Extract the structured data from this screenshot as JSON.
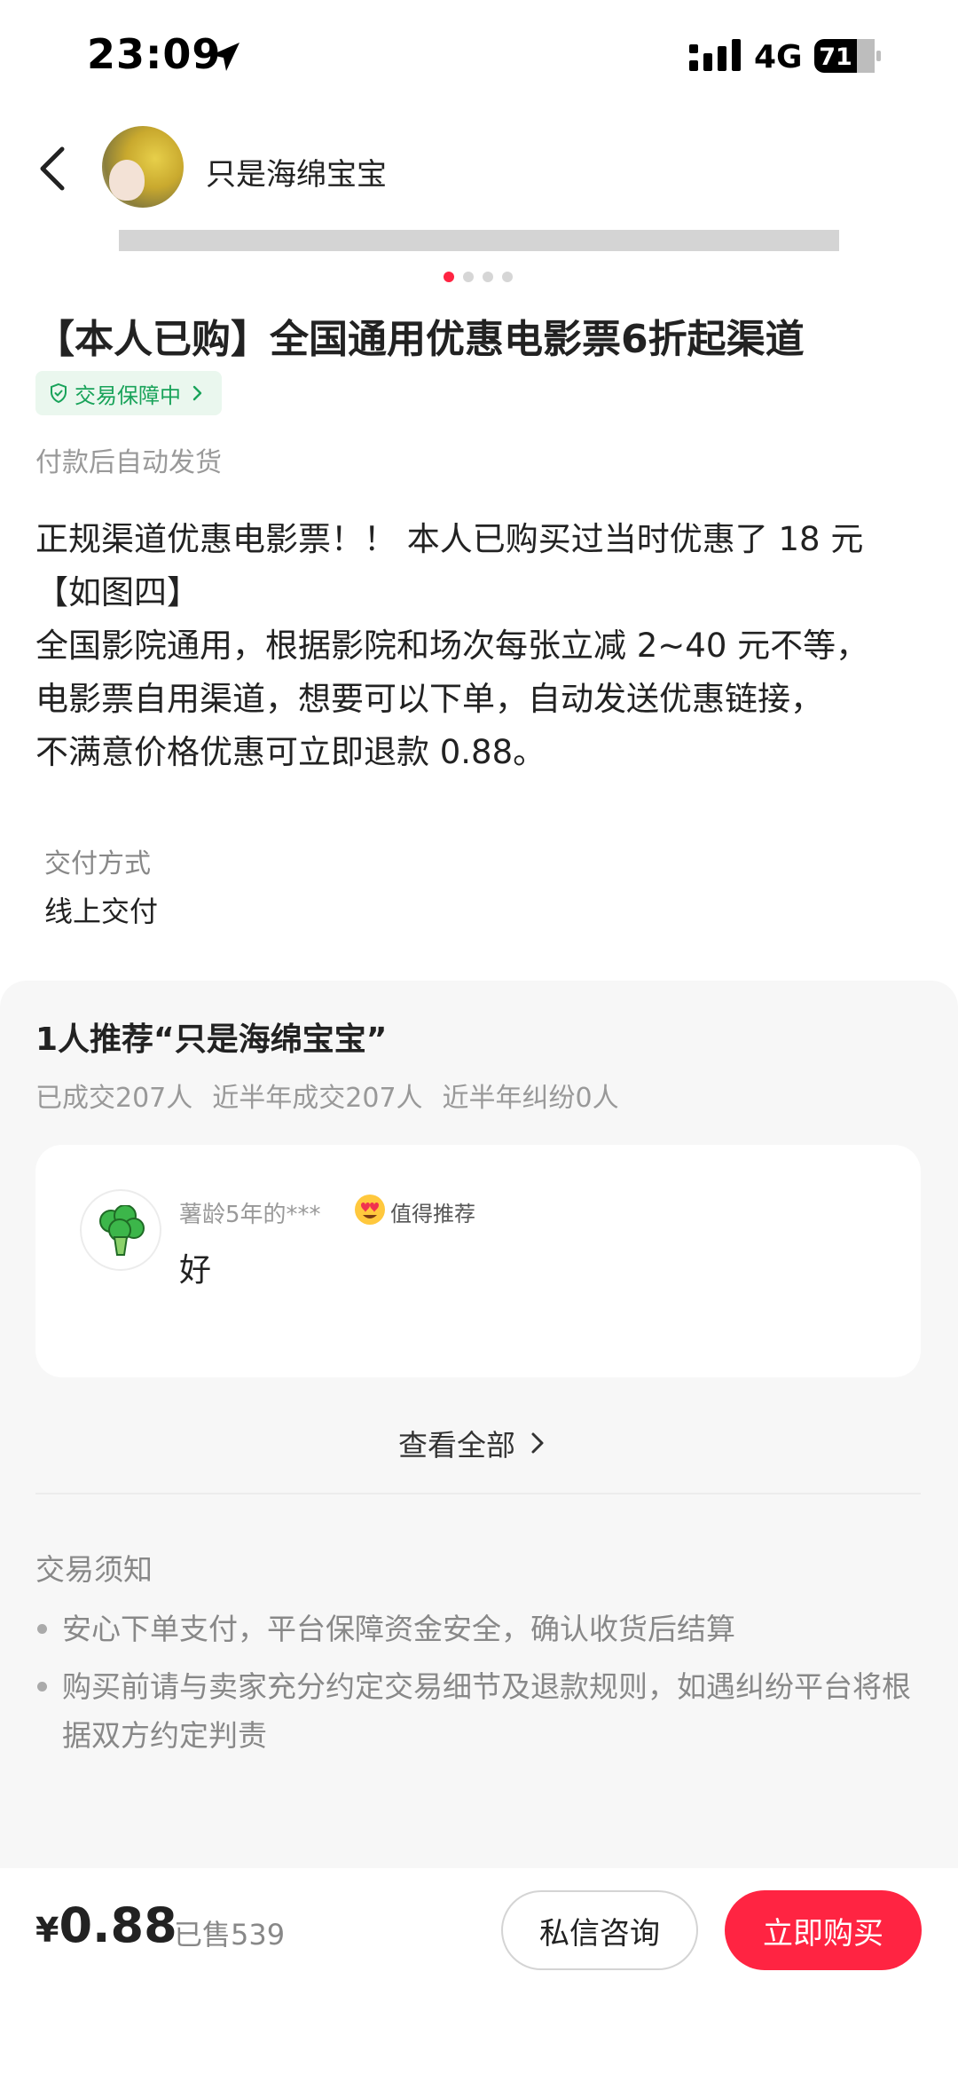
{
  "status_bar": {
    "time": "23:09",
    "network": "4G",
    "battery": "71"
  },
  "header": {
    "seller_name": "只是海绵宝宝"
  },
  "gallery": {
    "dot_count": 4,
    "active_index": 0
  },
  "product": {
    "title": "【本人已购】全国通用优惠电影票6折起渠道",
    "guarantee_badge": "交易保障中",
    "delivery_note": "付款后自动发货",
    "description_lines": [
      "正规渠道优惠电影票！！ 本人已购买过当时优惠了 18 元",
      "【如图四】",
      "全国影院通用，根据影院和场次每张立减 2~40 元不等，",
      "电影票自用渠道，想要可以下单，自动发送优惠链接，",
      "不满意价格优惠可立即退款 0.88。"
    ],
    "delivery_method_label": "交付方式",
    "delivery_method_value": "线上交付"
  },
  "recommendation": {
    "title": "1人推荐“只是海绵宝宝”",
    "stats": [
      "已成交207人",
      "近半年成交207人",
      "近半年纠纷0人"
    ],
    "review": {
      "reviewer": "薯龄5年的***",
      "tag": "值得推荐",
      "text": "好"
    },
    "view_all": "查看全部"
  },
  "notice": {
    "title": "交易须知",
    "items": [
      "安心下单支付，平台保障资金安全，确认收货后结算",
      "购买前请与卖家充分约定交易细节及退款规则，如遇纠纷平台将根据双方约定判责"
    ]
  },
  "bottom": {
    "currency": "¥",
    "price": "0.88",
    "sold": "已售539",
    "consult_button": "私信咨询",
    "buy_button": "立即购买"
  },
  "colors": {
    "accent": "#ff2442",
    "guarantee_green": "#19a35a",
    "guarantee_bg": "#eaf7ee"
  }
}
